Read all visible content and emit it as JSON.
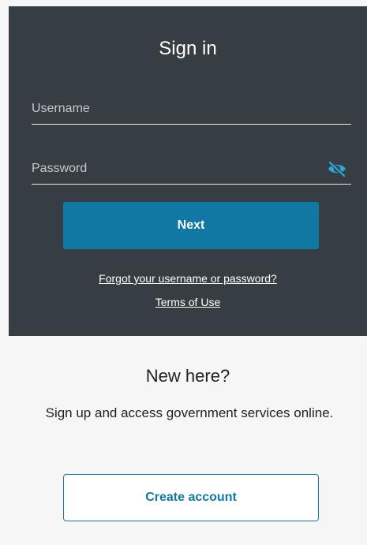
{
  "signin": {
    "title": "Sign in",
    "username_placeholder": "Username",
    "password_placeholder": "Password",
    "password_toggle_icon": "eye-off-icon",
    "next_label": "Next",
    "forgot_link": "Forgot your username or password?",
    "terms_link": "Terms of Use"
  },
  "register": {
    "title": "New here?",
    "description": "Sign up and access government services online.",
    "create_label": "Create account"
  },
  "colors": {
    "panel_background": "#363e44",
    "accent": "#1178a3",
    "page_background": "#f6f6f6",
    "eye_icon": "#2aa8d8"
  }
}
